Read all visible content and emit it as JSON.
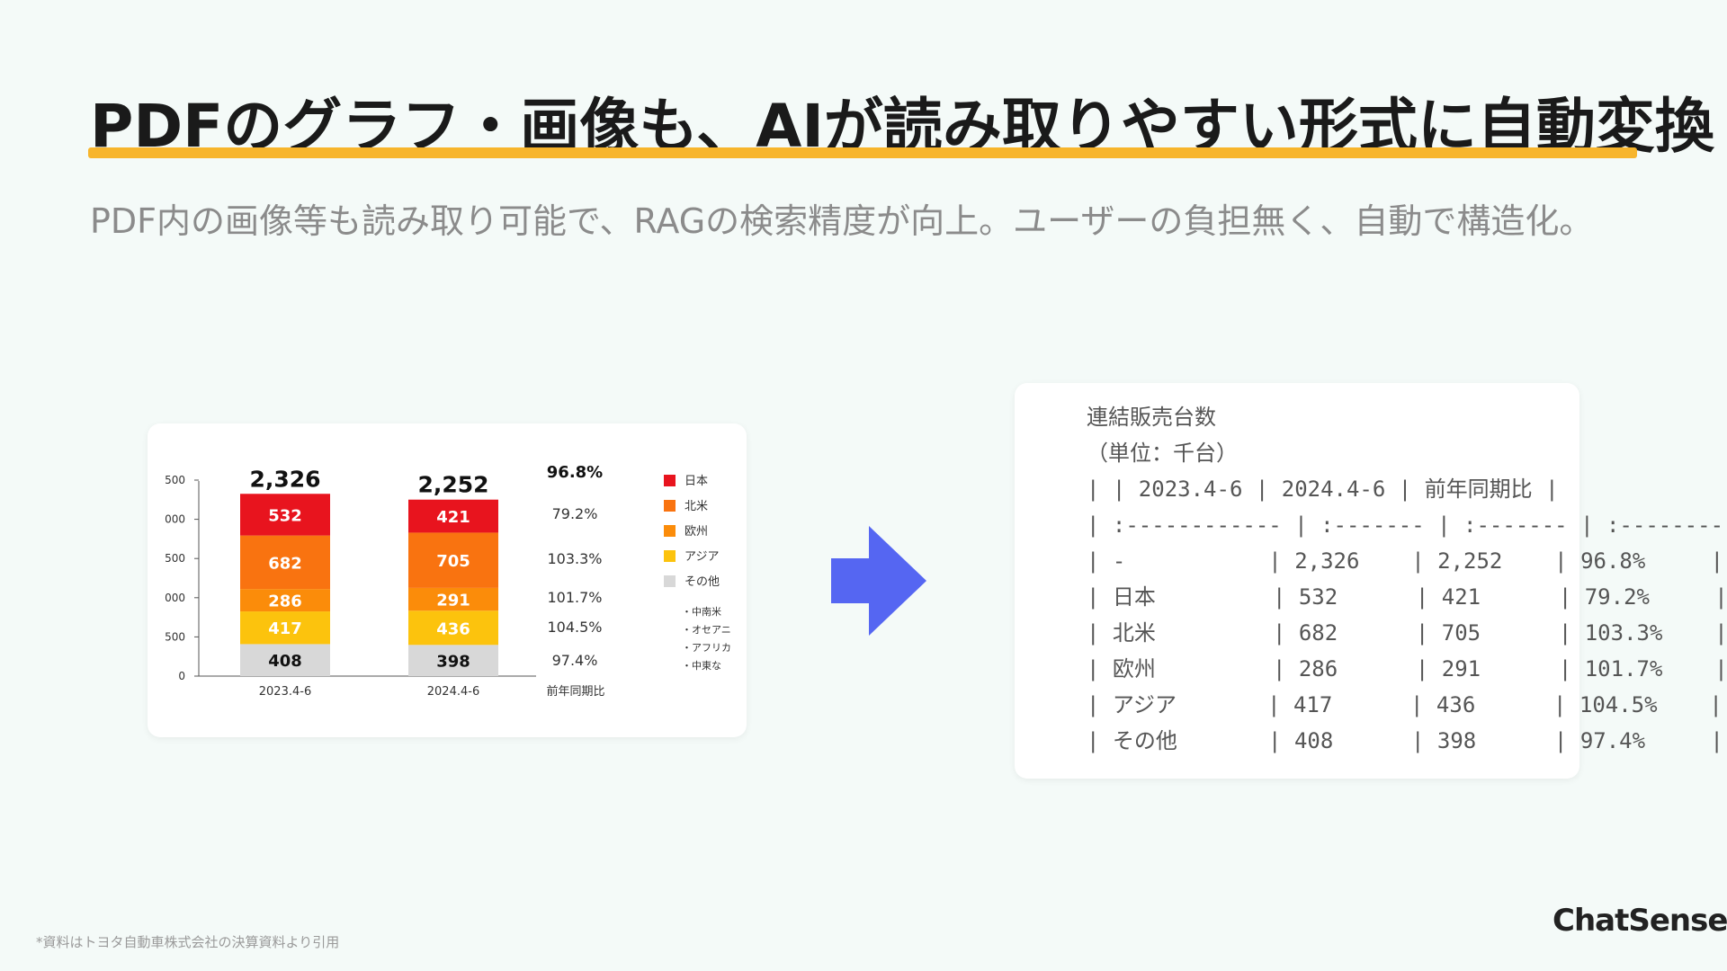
{
  "header": {
    "title": "PDFのグラフ・画像も、AIが読み取りやすい形式に自動変換",
    "subtitle": "PDF内の画像等も読み取り可能で、RAGの検索精度が向上。ユーザーの負担無く、自動で構造化。"
  },
  "chart_data": {
    "type": "bar",
    "stacked": true,
    "categories": [
      "2023.4-6",
      "2024.4-6"
    ],
    "series": [
      {
        "name": "その他",
        "values": [
          408,
          398
        ],
        "color": "#d8d8d8"
      },
      {
        "name": "アジア",
        "values": [
          417,
          436
        ],
        "color": "#fcc30d"
      },
      {
        "name": "欧州",
        "values": [
          286,
          291
        ],
        "color": "#fb8c0a"
      },
      {
        "name": "北米",
        "values": [
          682,
          705
        ],
        "color": "#f97310"
      },
      {
        "name": "日本",
        "values": [
          532,
          421
        ],
        "color": "#e8141e"
      }
    ],
    "totals": [
      "2,326",
      "2,252"
    ],
    "ytick_labels": [
      "0",
      "500",
      "000",
      "500",
      "000",
      "500"
    ],
    "ylim": [
      0,
      2500
    ],
    "ratio_header": "前年同期比",
    "ratio_total": "96.8%",
    "ratios": [
      "79.2%",
      "103.3%",
      "101.7%",
      "104.5%",
      "97.4%"
    ],
    "legend": [
      "日本",
      "北米",
      "欧州",
      "アジア",
      "その他"
    ],
    "legend_colors": [
      "#e8141e",
      "#f97310",
      "#fb8c0a",
      "#fcc30d",
      "#d8d8d8"
    ],
    "legend_sub": [
      "・中南米",
      "・オセアニ",
      "・アフリカ",
      "・中東な"
    ],
    "legend_position": "right"
  },
  "markdown": {
    "lines": [
      "連結販売台数",
      "（単位：千台）",
      "| | 2023.4-6 | 2024.4-6 | 前年同期比 |",
      "| :------------ | :------- | :------- | :--------- |",
      "| -           | 2,326    | 2,252    | 96.8%     |",
      "| 日本         | 532      | 421      | 79.2%     |",
      "| 北米         | 682      | 705      | 103.3%    |",
      "| 欧州         | 286      | 291      | 101.7%    |",
      "| アジア       | 417      | 436      | 104.5%    |",
      "| その他       | 408      | 398      | 97.4%     |"
    ]
  },
  "footer": {
    "note": "*資料はトヨタ自動車株式会社の決算資料より引用",
    "brand": "ChatSense"
  },
  "colors": {
    "accent_underline": "#f7b52c",
    "arrow": "#5566f2"
  }
}
